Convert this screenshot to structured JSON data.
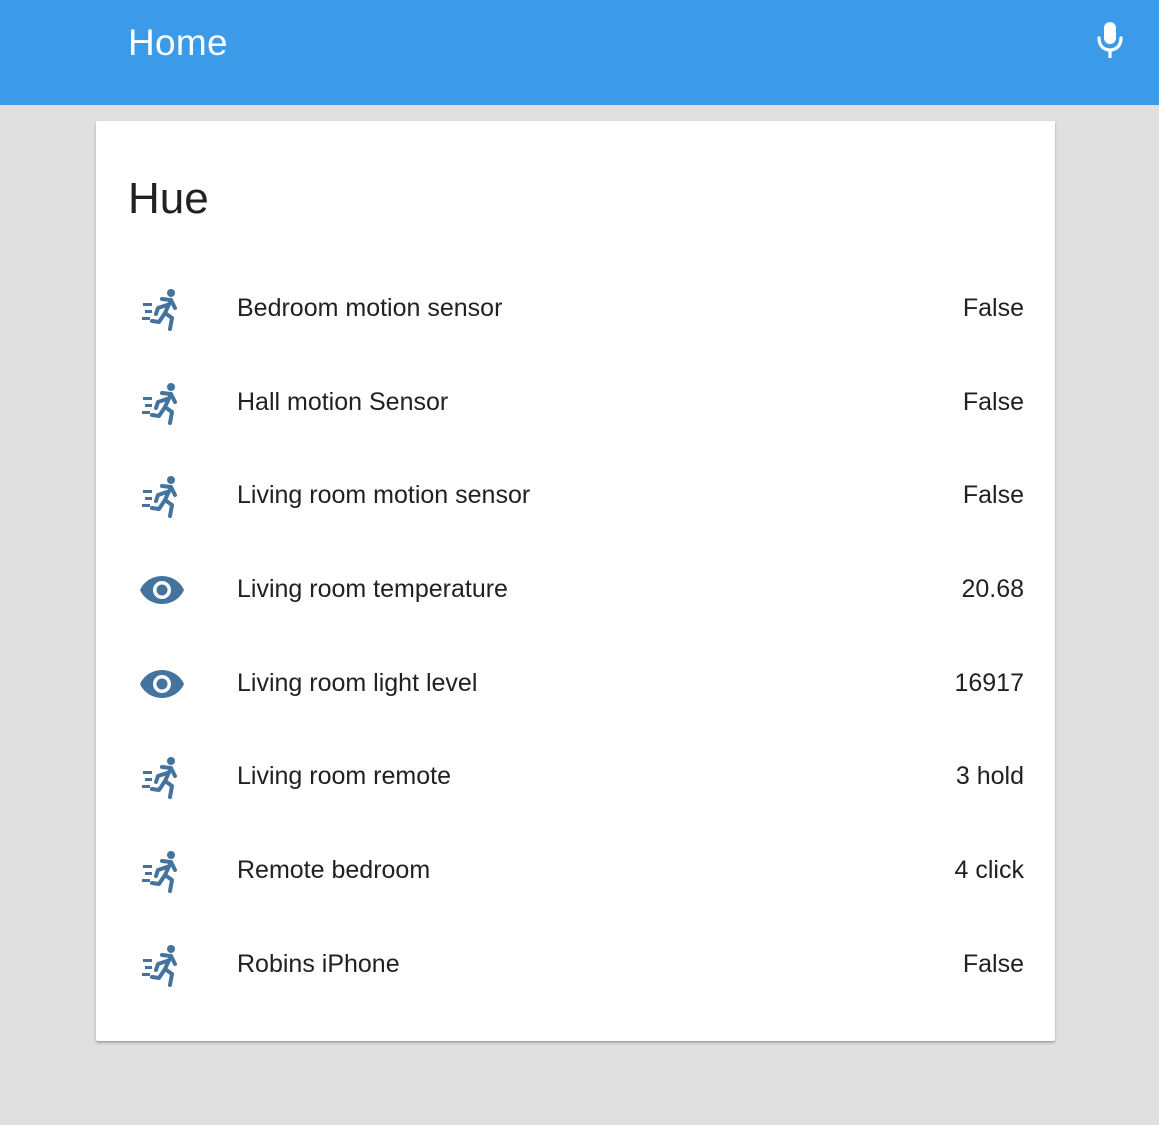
{
  "header": {
    "title": "Home",
    "mic_icon": "microphone-icon"
  },
  "colors": {
    "header_bg": "#3c9be8",
    "page_bg": "#e0e0e0",
    "icon": "#44739e"
  },
  "card": {
    "title": "Hue",
    "entities": [
      {
        "name": "Bedroom motion sensor",
        "state": "False",
        "icon": "run-icon"
      },
      {
        "name": "Hall motion Sensor",
        "state": "False",
        "icon": "run-icon"
      },
      {
        "name": "Living room motion sensor",
        "state": "False",
        "icon": "run-icon"
      },
      {
        "name": "Living room temperature",
        "state": "20.68",
        "icon": "eye-icon"
      },
      {
        "name": "Living room light level",
        "state": "16917",
        "icon": "eye-icon"
      },
      {
        "name": "Living room remote",
        "state": "3 hold",
        "icon": "run-icon"
      },
      {
        "name": "Remote bedroom",
        "state": "4 click",
        "icon": "run-icon"
      },
      {
        "name": "Robins iPhone",
        "state": "False",
        "icon": "run-icon"
      }
    ]
  }
}
